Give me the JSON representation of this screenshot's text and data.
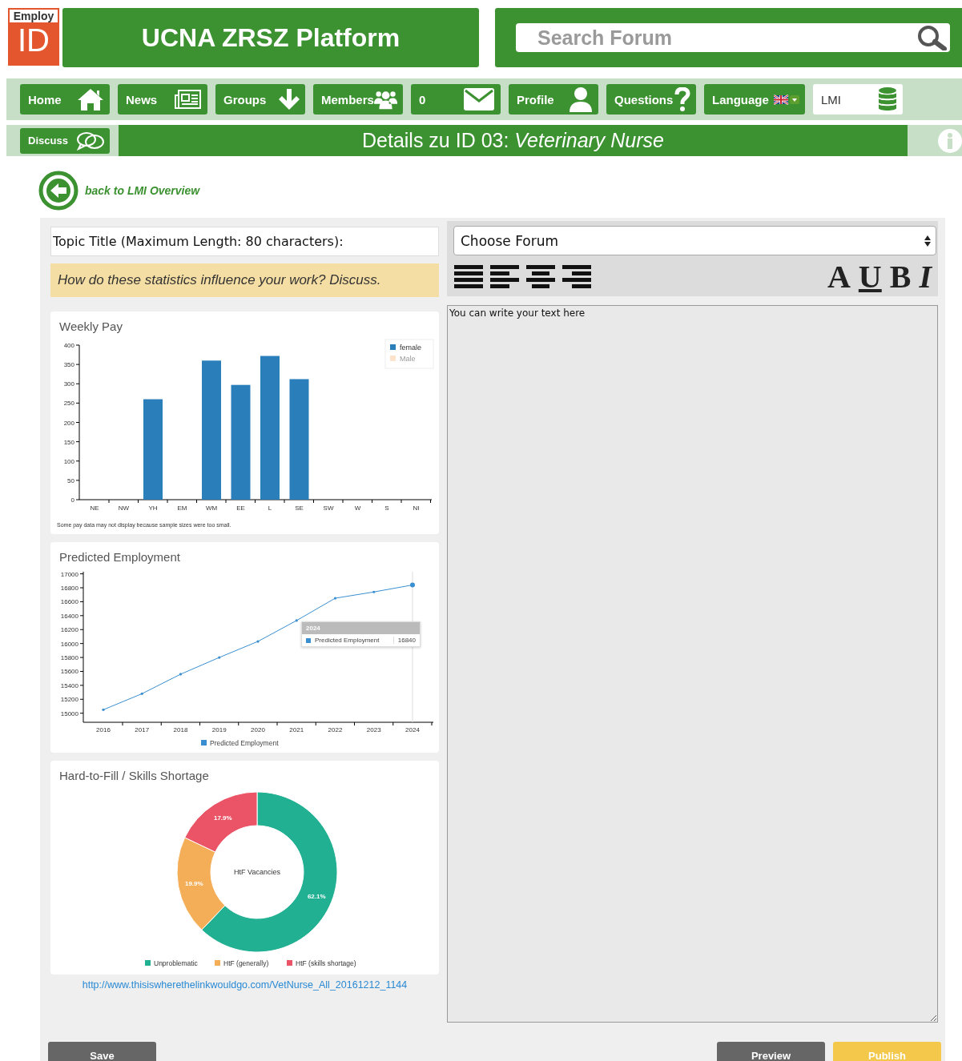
{
  "logo": {
    "top": "Employ",
    "main": "ID"
  },
  "title": "UCNA ZRSZ Platform",
  "search": {
    "placeholder": "Search Forum"
  },
  "nav": [
    {
      "label": "Home",
      "kind": "home",
      "selected": false
    },
    {
      "label": "News",
      "kind": "news",
      "selected": false
    },
    {
      "label": "Groups",
      "kind": "down",
      "selected": false
    },
    {
      "label": "Members",
      "kind": "people",
      "selected": false
    },
    {
      "label": "0",
      "kind": "mail",
      "selected": false
    },
    {
      "label": "Profile",
      "kind": "person",
      "selected": false
    },
    {
      "label": "Questions",
      "kind": "question",
      "selected": false
    },
    {
      "label": "Language",
      "kind": "flag",
      "selected": false
    },
    {
      "label": "LMI",
      "kind": "database",
      "selected": true
    }
  ],
  "subnav": {
    "discuss": "Discuss",
    "heading": "Details zu ID 03: *Veterinary Nurse*"
  },
  "back_link": "back to LMI Overview",
  "topic_field": {
    "placeholder": "Topic Title (Maximum Length: 80 characters):"
  },
  "prompt": "How do these statistics influence your work? Discuss.",
  "charts": [
    {
      "title": "Weekly Pay",
      "note": "Some pay data may not display because sample sizes were too small.",
      "chart_data": {
        "type": "bar",
        "categories": [
          "NE",
          "NW",
          "YH",
          "EM",
          "WM",
          "EE",
          "L",
          "SE",
          "SW",
          "W",
          "S",
          "NI"
        ],
        "series": [
          {
            "name": "female",
            "color": "#2a7fba",
            "values": [
              null,
              null,
              260,
              null,
              360,
              297,
              372,
              312,
              null,
              null,
              null,
              null
            ]
          },
          {
            "name": "Male",
            "color": "#fde3cc",
            "values": [
              null,
              null,
              null,
              null,
              null,
              null,
              null,
              null,
              null,
              null,
              null,
              null
            ]
          }
        ],
        "ylim": [
          0,
          400
        ],
        "yticks": [
          0,
          50,
          100,
          150,
          200,
          250,
          300,
          350,
          400
        ],
        "legend": "top-right"
      }
    },
    {
      "title": "Predicted Employment",
      "tooltip": {
        "title": "2024",
        "label": "Predicted Employment",
        "value": "16840"
      },
      "chart_data": {
        "type": "line",
        "x": [
          "2016",
          "2017",
          "2018",
          "2019",
          "2020",
          "2021",
          "2022",
          "2023",
          "2024"
        ],
        "series": [
          {
            "name": "Predicted Employment",
            "color": "#3a8fd0",
            "values": [
              15050,
              15280,
              15560,
              15800,
              16030,
              16330,
              16650,
              16740,
              16840
            ]
          }
        ],
        "ylim": [
          14870,
          17030
        ],
        "yticks": [
          15000,
          15200,
          15400,
          15600,
          15800,
          16000,
          16200,
          16400,
          16600,
          16800,
          17000
        ],
        "legend": "bottom"
      }
    },
    {
      "title": "Hard-to-Fill / Skills Shortage",
      "chart_data": {
        "type": "donut",
        "categories": [
          "Unproblematic",
          "HtF (generally)",
          "HtF (skills shortage)"
        ],
        "series": [
          {
            "name": "HtF Vacancies",
            "values": [
              62.1,
              19.9,
              17.9
            ]
          }
        ],
        "colors": [
          "#22b093",
          "#f5ae58",
          "#ea5466"
        ],
        "value_labels": [
          "62.1%",
          "19.9%",
          "17.9%"
        ],
        "legend": "bottom"
      }
    }
  ],
  "source_link": "http://www.thisiswherethelinkwouldgo.com/VetNurse_All_20161212_1144",
  "forum_select": {
    "value": "Choose Forum"
  },
  "align_tools": [
    {
      "kind": "justify"
    },
    {
      "kind": "left"
    },
    {
      "kind": "center"
    },
    {
      "kind": "right"
    }
  ],
  "format_buttons": [
    {
      "label": "A",
      "kind": "font"
    },
    {
      "label": "U",
      "kind": "underline"
    },
    {
      "label": "B",
      "kind": "bold"
    },
    {
      "label": "I",
      "kind": "italic"
    }
  ],
  "editor": {
    "placeholder": "You can write your text here"
  },
  "buttons": [
    {
      "label": "Save",
      "kind": "secondary"
    },
    {
      "label": "Preview",
      "kind": "secondary"
    },
    {
      "label": "Publish",
      "kind": "primary"
    }
  ]
}
